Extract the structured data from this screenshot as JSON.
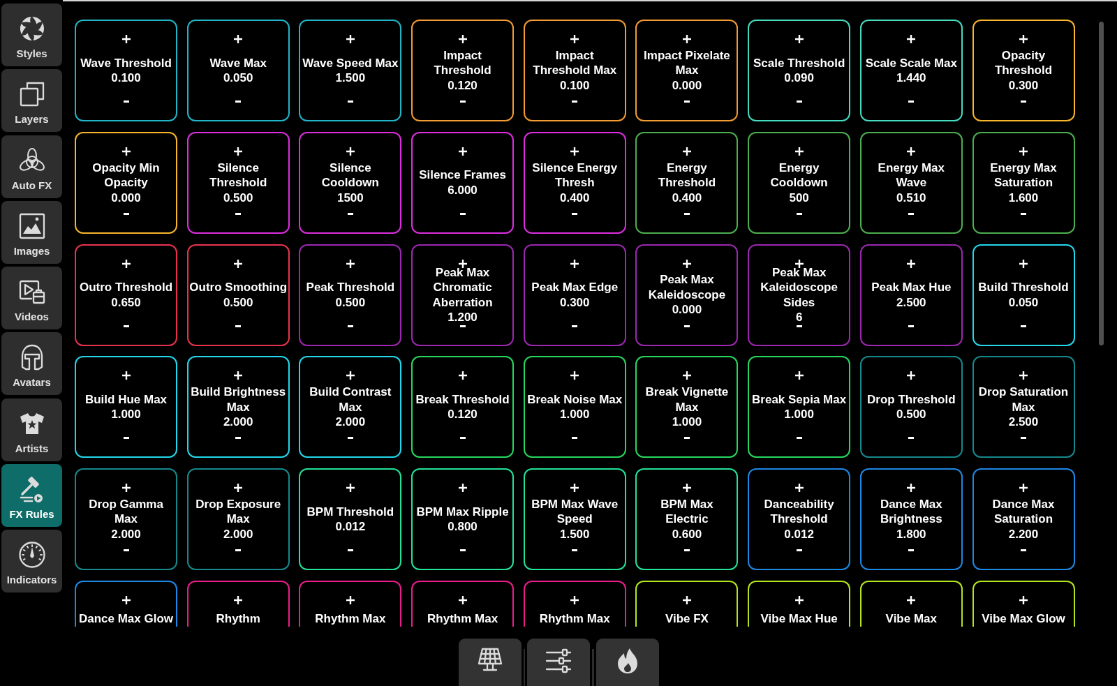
{
  "sidebar": {
    "items": [
      {
        "label": "Styles",
        "selected": false
      },
      {
        "label": "Layers",
        "selected": false
      },
      {
        "label": "Auto FX",
        "selected": false
      },
      {
        "label": "Images",
        "selected": false
      },
      {
        "label": "Videos",
        "selected": false
      },
      {
        "label": "Avatars",
        "selected": false
      },
      {
        "label": "Artists",
        "selected": false
      },
      {
        "label": "FX Rules",
        "selected": true
      },
      {
        "label": "Indicators",
        "selected": false
      }
    ]
  },
  "rules": {
    "cards": [
      {
        "name": "Wave Threshold",
        "value": "0.100",
        "color": "#22b5c8"
      },
      {
        "name": "Wave Max",
        "value": "0.050",
        "color": "#22b5c8"
      },
      {
        "name": "Wave Speed Max",
        "value": "1.500",
        "color": "#22b5c8"
      },
      {
        "name": "Impact Threshold",
        "value": "0.120",
        "color": "#f29c33"
      },
      {
        "name": "Impact Threshold Max",
        "value": "0.100",
        "color": "#f29c33"
      },
      {
        "name": "Impact Pixelate Max",
        "value": "0.000",
        "color": "#f29c33"
      },
      {
        "name": "Scale Threshold",
        "value": "0.090",
        "color": "#45dcc0"
      },
      {
        "name": "Scale Scale Max",
        "value": "1.440",
        "color": "#45dcc0"
      },
      {
        "name": "Opacity Threshold",
        "value": "0.300",
        "color": "#f7b62c"
      },
      {
        "name": "Opacity Min Opacity",
        "value": "0.000",
        "color": "#f7b62c"
      },
      {
        "name": "Silence Threshold",
        "value": "0.500",
        "color": "#dd2edf"
      },
      {
        "name": "Silence Cooldown",
        "value": "1500",
        "color": "#dd2edf"
      },
      {
        "name": "Silence Frames",
        "value": "6.000",
        "color": "#dd2edf"
      },
      {
        "name": "Silence Energy Thresh",
        "value": "0.400",
        "color": "#dd2edf"
      },
      {
        "name": "Energy Threshold",
        "value": "0.400",
        "color": "#4caf50"
      },
      {
        "name": "Energy Cooldown",
        "value": "500",
        "color": "#4caf50"
      },
      {
        "name": "Energy Max Wave",
        "value": "0.510",
        "color": "#4caf50"
      },
      {
        "name": "Energy Max Saturation",
        "value": "1.600",
        "color": "#4caf50"
      },
      {
        "name": "Outro Threshold",
        "value": "0.650",
        "color": "#e8334f"
      },
      {
        "name": "Outro Smoothing",
        "value": "0.500",
        "color": "#e8334f"
      },
      {
        "name": "Peak Threshold",
        "value": "0.500",
        "color": "#9c27b0"
      },
      {
        "name": "Peak Max Chromatic Aberration",
        "value": "1.200",
        "color": "#9c27b0"
      },
      {
        "name": "Peak Max Edge",
        "value": "0.300",
        "color": "#9c27b0"
      },
      {
        "name": "Peak Max Kaleidoscope",
        "value": "0.000",
        "color": "#9c27b0"
      },
      {
        "name": "Peak Max Kaleidoscope Sides",
        "value": "6",
        "color": "#9c27b0"
      },
      {
        "name": "Peak Max Hue",
        "value": "2.500",
        "color": "#9c27b0"
      },
      {
        "name": "Build Threshold",
        "value": "0.050",
        "color": "#22d8ec"
      },
      {
        "name": "Build Hue Max",
        "value": "1.000",
        "color": "#22d8ec"
      },
      {
        "name": "Build Brightness Max",
        "value": "2.000",
        "color": "#22d8ec"
      },
      {
        "name": "Build Contrast Max",
        "value": "2.000",
        "color": "#22d8ec"
      },
      {
        "name": "Break Threshold",
        "value": "0.120",
        "color": "#27d85f"
      },
      {
        "name": "Break Noise Max",
        "value": "1.000",
        "color": "#27d85f"
      },
      {
        "name": "Break Vignette Max",
        "value": "1.000",
        "color": "#27d85f"
      },
      {
        "name": "Break Sepia Max",
        "value": "1.000",
        "color": "#27d85f"
      },
      {
        "name": "Drop Threshold",
        "value": "0.500",
        "color": "#16898c"
      },
      {
        "name": "Drop Saturation Max",
        "value": "2.500",
        "color": "#16898c"
      },
      {
        "name": "Drop Gamma Max",
        "value": "2.000",
        "color": "#16898c"
      },
      {
        "name": "Drop Exposure Max",
        "value": "2.000",
        "color": "#16898c"
      },
      {
        "name": "BPM Threshold",
        "value": "0.012",
        "color": "#22e39a"
      },
      {
        "name": "BPM Max Ripple",
        "value": "0.800",
        "color": "#22e39a"
      },
      {
        "name": "BPM Max Wave Speed",
        "value": "1.500",
        "color": "#22e39a"
      },
      {
        "name": "BPM Max Electric",
        "value": "0.600",
        "color": "#22e39a"
      },
      {
        "name": "Danceability Threshold",
        "value": "0.012",
        "color": "#1e88e5"
      },
      {
        "name": "Dance Max Brightness",
        "value": "1.800",
        "color": "#1e88e5"
      },
      {
        "name": "Dance Max Saturation",
        "value": "2.200",
        "color": "#1e88e5"
      },
      {
        "name": "Dance Max Glow",
        "color": "#1e88e5"
      },
      {
        "name": "Rhythm",
        "color": "#e91e8c"
      },
      {
        "name": "Rhythm Max",
        "color": "#e91e8c"
      },
      {
        "name": "Rhythm Max",
        "color": "#e91e8c"
      },
      {
        "name": "Rhythm Max",
        "color": "#e91e8c"
      },
      {
        "name": "Vibe FX",
        "color": "#b4e61e"
      },
      {
        "name": "Vibe Max Hue",
        "color": "#b4e61e"
      },
      {
        "name": "Vibe Max",
        "color": "#b4e61e"
      },
      {
        "name": "Vibe Max Glow",
        "color": "#b4e61e"
      }
    ]
  }
}
